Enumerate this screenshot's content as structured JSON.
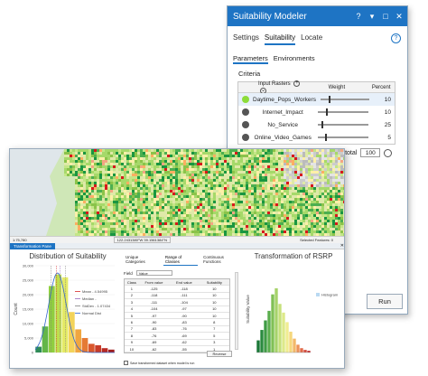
{
  "suitability_pane": {
    "title": "Suitability Modeler",
    "title_controls": [
      "?",
      "▾",
      "□",
      "✕"
    ],
    "tabs": [
      {
        "label": "Settings",
        "active": false
      },
      {
        "label": "Suitability",
        "active": true
      },
      {
        "label": "Locate",
        "active": false
      }
    ],
    "help_icon": "?",
    "subtabs": [
      {
        "label": "Parameters",
        "active": true
      },
      {
        "label": "Environments",
        "active": false
      }
    ],
    "criteria_label": "Criteria",
    "table_headers": {
      "input_rasters": "Input Rasters",
      "weight": "Weight",
      "percent": "Percent"
    },
    "criteria": [
      {
        "name": "Daytime_Pops_Workers",
        "weight": 0.15,
        "percent": "10",
        "status": "active",
        "selected": true
      },
      {
        "name": "Internet_Impact",
        "weight": 0.15,
        "percent": "10",
        "status": "inactive",
        "selected": false
      },
      {
        "name": "No_Service",
        "weight": 0.06,
        "percent": "25",
        "status": "inactive",
        "selected": false
      },
      {
        "name": "Online_Video_Games",
        "weight": 0.14,
        "percent": "5",
        "status": "inactive",
        "selected": false
      }
    ],
    "percent_total_label": "Percent total",
    "percent_total": "100",
    "run_label": "Run",
    "colors": {
      "title_bar": "#1e74c4",
      "active_dot": "#8ddc3a",
      "inactive_dot": "#555555"
    }
  },
  "map": {
    "scale": "1:75,780",
    "coordinates": "122.2431380°W 39.1561384°N",
    "selected_features": "Selected Features: 0",
    "pause_icon": "pause-icon"
  },
  "transformation_pane": {
    "tab_label": "Transformation Pane",
    "distribution": {
      "title": "Distribution of Suitability",
      "ylabel": "Count",
      "legend": [
        "Mean - 4.54995",
        "Median -",
        "StdDev - 1.07434",
        "Normal Dist"
      ]
    },
    "classes": {
      "tabs": [
        {
          "label": "Unique Categories",
          "active": false
        },
        {
          "label": "Range of Classes",
          "active": true
        },
        {
          "label": "Continuous Functions",
          "active": false
        }
      ],
      "field_label": "Field",
      "field_value": "Value",
      "headers": [
        "Class",
        "From value",
        "End value",
        "Suitability"
      ],
      "rows": [
        [
          "1",
          "-125",
          "-118",
          "10"
        ],
        [
          "2",
          "-118",
          "-111",
          "10"
        ],
        [
          "3",
          "-111",
          "-104",
          "10"
        ],
        [
          "4",
          "-104",
          "-97",
          "10"
        ],
        [
          "5",
          "-97",
          "-90",
          "10"
        ],
        [
          "6",
          "-90",
          "-83",
          "8"
        ],
        [
          "7",
          "-83",
          "-76",
          "7"
        ],
        [
          "8",
          "-76",
          "-69",
          "5"
        ],
        [
          "9",
          "-69",
          "-62",
          "3"
        ],
        [
          "10",
          "-62",
          "-55",
          "1"
        ]
      ],
      "reverse_label": "Reverse",
      "save_label": "Save transformed dataset when model is run"
    },
    "rsrp": {
      "title": "Transformation of RSRP",
      "ylabel": "Suitability Value",
      "legend": "Histogram"
    }
  },
  "chart_data": [
    {
      "type": "bar",
      "title": "Distribution of Suitability",
      "ylabel": "Count",
      "ylim": [
        0,
        30000
      ],
      "yticks": [
        "0",
        "5,000",
        "10,000",
        "15,000",
        "20,000",
        "25,000",
        "30,000"
      ],
      "values": [
        2000,
        9000,
        23000,
        27000,
        26000,
        14000,
        8000,
        5000,
        3000,
        2500,
        1500,
        1000
      ],
      "colors": [
        "#2e8b57",
        "#63b648",
        "#8fce3f",
        "#bedf4c",
        "#e4ea66",
        "#f3d35a",
        "#f0a640",
        "#e57a34",
        "#d9572d",
        "#c83c28",
        "#b82a22",
        "#a21e1e"
      ],
      "lines": [
        "Mean - 4.54995",
        "Median -",
        "StdDev - 1.07434",
        "Normal Dist"
      ]
    },
    {
      "type": "bar",
      "title": "Transformation of RSRP",
      "ylabel": "Suitability Value",
      "ylim": [
        0,
        10
      ],
      "legend": "Histogram",
      "values": [
        1.4,
        2.6,
        3.7,
        4.8,
        6.7,
        7.4,
        5.6,
        4.6,
        3.5,
        2.4,
        1.6,
        0.9,
        0.5,
        0.3,
        0.2
      ],
      "colors": [
        "#1a7837",
        "#2a8a3f",
        "#3f9b45",
        "#5aae4d",
        "#80c055",
        "#a6d26a",
        "#c6e07b",
        "#dde98a",
        "#f0ed91",
        "#f5d77c",
        "#f2b86a",
        "#ec9259",
        "#e26b4a",
        "#d44a3d",
        "#c12f31"
      ]
    }
  ]
}
